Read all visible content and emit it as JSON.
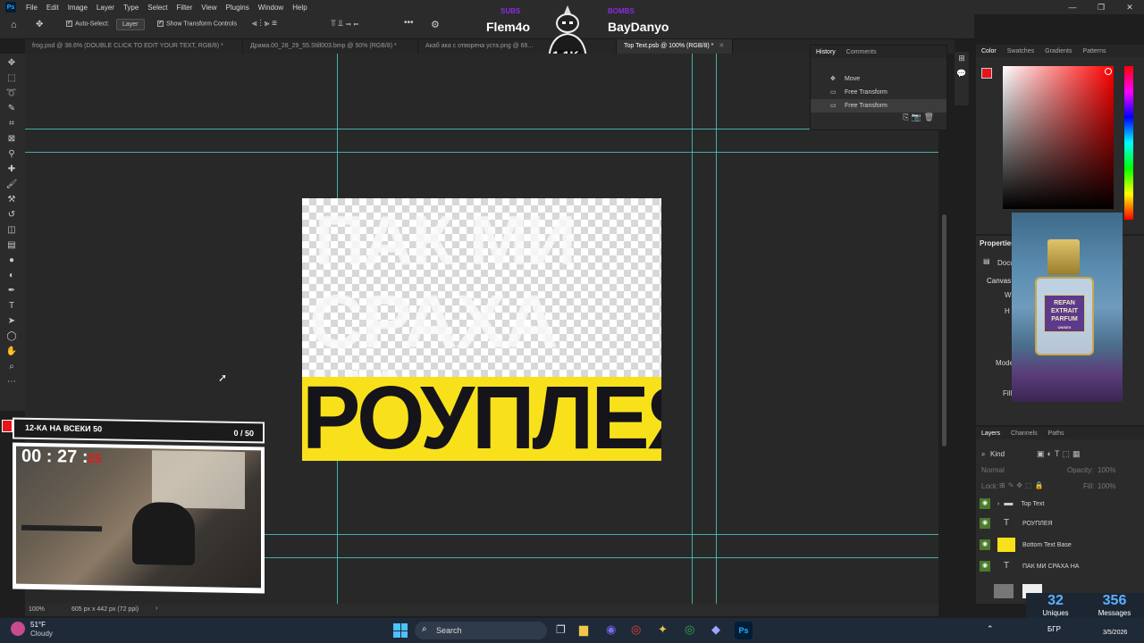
{
  "menubar": {
    "items": [
      "File",
      "Edit",
      "Image",
      "Layer",
      "Type",
      "Select",
      "Filter",
      "View",
      "Plugins",
      "Window",
      "Help"
    ]
  },
  "options": {
    "auto_select": "Auto-Select:",
    "layer_select": "Layer",
    "show_transform": "Show Transform Controls",
    "more": "•••"
  },
  "tabs": [
    {
      "label": "frog.psd @ 38.6% (DOUBLE CLICK TO EDIT YOUR TEXT, RGB/8) *",
      "active": false
    },
    {
      "label": "Драма.00_28_29_55.Still003.bmp @ 50% (RGB/8) *",
      "active": false
    },
    {
      "label": "Акаб ака с отворена уста.png @ 66...",
      "active": false
    },
    {
      "label": "Top Text.psb @ 100% (RGB/8) *",
      "active": true
    }
  ],
  "document": {
    "line1": "ПАК МИ",
    "line2": "СРАХА НА",
    "bottom": "РОУПЛЕЯ",
    "bottom_color": "#f8e11b"
  },
  "status": {
    "zoom": "100%",
    "size": "605 px x 442 px (72 ppi)"
  },
  "overlay": {
    "left_tag": "SUBS",
    "left_name": "Flem4o",
    "right_tag": "BOMBS",
    "right_name": "BayDanyo",
    "count": "1.1K",
    "webcam_title": "12-КА НА ВСЕКИ 50",
    "webcam_count": "0 / 50",
    "timer_main": "00 : 27 :",
    "timer_sec": "25",
    "uniques_value": "32",
    "uniques_label": "Uniques",
    "messages_value": "356",
    "messages_label": "Messages"
  },
  "history": {
    "tabs": [
      "History",
      "Comments"
    ],
    "items": [
      "Move",
      "Free Transform",
      "Free Transform"
    ]
  },
  "color_panel": {
    "tabs": [
      "Color",
      "Swatches",
      "Gradients",
      "Patterns"
    ],
    "fg": "#e8141c"
  },
  "properties": {
    "title": "Properties",
    "doc": "Docu",
    "canvas": "Canvas",
    "w": "W",
    "h": "H",
    "mode": "Mode",
    "fill": "Fill"
  },
  "layers": {
    "tabs": [
      "Layers",
      "Channels",
      "Paths"
    ],
    "kind": "Kind",
    "blend": "Normal",
    "opacity": "Opacity:",
    "opacity_val": "100%",
    "lock": "Lock:",
    "fill": "Fill:",
    "fill_val": "100%",
    "rows": [
      {
        "name": "Top Text",
        "icon": "folder"
      },
      {
        "name": "РОУПЛЕЯ",
        "icon": "text"
      },
      {
        "name": "Bottom Text Base",
        "icon": "image"
      },
      {
        "name": "ПАК МИ СРАХА НА",
        "icon": "text"
      }
    ]
  },
  "perfume": {
    "line1": "REFAN",
    "line2": "EXTRAIT",
    "line3": "PARFUM",
    "line4": "UNISEX"
  },
  "taskbar": {
    "weather_temp": "51°F",
    "weather_desc": "Cloudy",
    "search": "Search",
    "lang": "БГР",
    "date": "3/5/2026"
  }
}
